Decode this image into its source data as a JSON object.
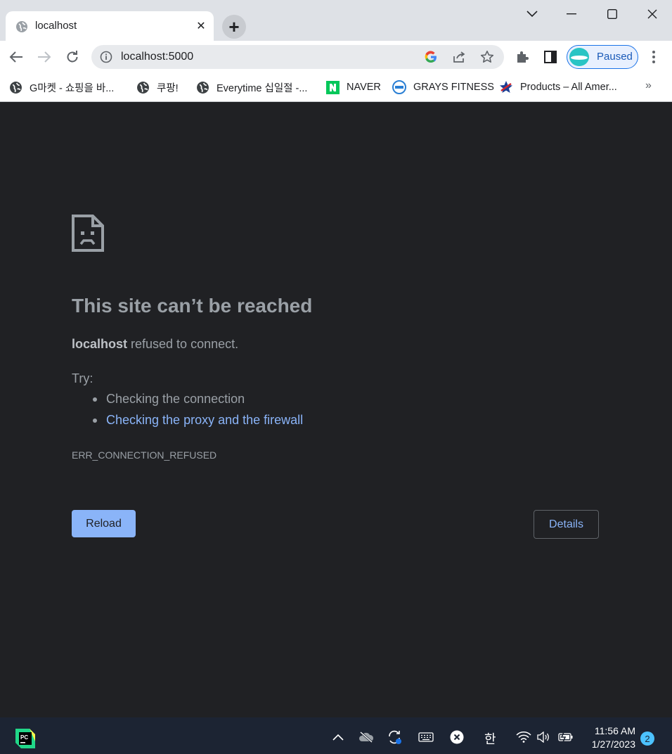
{
  "browser": {
    "tab": {
      "title": "localhost",
      "close_glyph": "✕"
    },
    "new_tab_glyph": "+",
    "omnibox": {
      "url": "localhost:5000"
    },
    "profile": {
      "label": "Paused"
    },
    "bookmarks": [
      {
        "label": "G마켓 - 쇼핑을 바...",
        "icon": "globe-icon"
      },
      {
        "label": "쿠팡!",
        "icon": "globe-icon"
      },
      {
        "label": "Everytime 십일절 -...",
        "icon": "globe-icon"
      },
      {
        "label": "NAVER",
        "icon": "naver-icon"
      },
      {
        "label": "GRAYS FITNESS",
        "icon": "grays-icon"
      },
      {
        "label": "Products – All Amer...",
        "icon": "star-logo-icon"
      }
    ],
    "bookmarks_overflow": "»"
  },
  "error_page": {
    "title": "This site can’t be reached",
    "host": "localhost",
    "summary_rest": " refused to connect.",
    "try_label": "Try:",
    "suggestions": [
      {
        "text": "Checking the connection",
        "is_link": false
      },
      {
        "text": "Checking the proxy and the firewall",
        "is_link": true
      }
    ],
    "error_code": "ERR_CONNECTION_REFUSED",
    "reload_label": "Reload",
    "details_label": "Details"
  },
  "taskbar": {
    "ime_label": "한",
    "time": "11:56 AM",
    "date": "1/27/2023",
    "notification_count": "2"
  },
  "colors": {
    "page_bg": "#202124",
    "accent": "#8ab4f8",
    "muted_text": "#9aa0a6",
    "taskbar_bg": "#1c2433"
  }
}
